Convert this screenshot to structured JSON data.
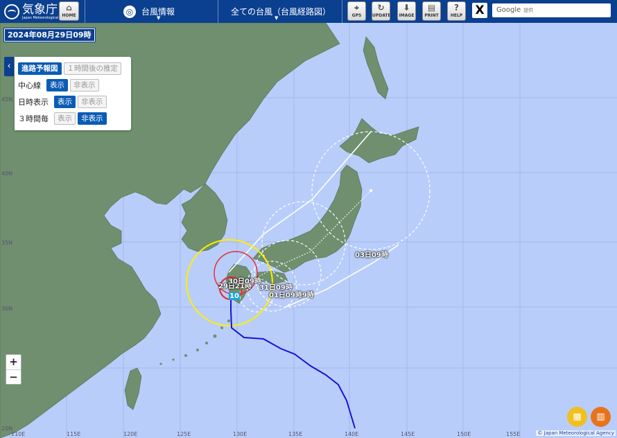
{
  "header": {
    "logo_jp": "気象庁",
    "logo_en": "Japan Meteorological Agency",
    "home_label": "HOME",
    "menu_typhoon_info": "台風情報",
    "menu_all_typhoons": "全ての台風（台風経路図）",
    "tools": [
      {
        "label": "GPS",
        "icon": "crosshair-icon"
      },
      {
        "label": "UPDATE",
        "icon": "refresh-icon"
      },
      {
        "label": "IMAGE",
        "icon": "download-icon"
      },
      {
        "label": "PRINT",
        "icon": "printer-icon"
      },
      {
        "label": "HELP",
        "icon": "question-icon"
      }
    ],
    "x_label": "X",
    "search_brand": "Google",
    "search_suffix": "提供"
  },
  "date_label": "2024年08月29日09時",
  "panel": {
    "forecast_tab": "進路予報図",
    "estimate_tab": "１時間後の推定",
    "centerline_label": "中心線",
    "datetime_label": "日時表示",
    "threehour_label": "３時間毎",
    "show": "表示",
    "hide": "非表示"
  },
  "map_labels": {
    "t1": "29日21時",
    "t2": "30日09時",
    "t3": "31日09時",
    "t4": "01日09時",
    "t4b": "9時",
    "t5": "03日09時",
    "typhoon_number": "10"
  },
  "lon_labels": [
    "110E",
    "115E",
    "120E",
    "125E",
    "130E",
    "135E",
    "140E",
    "145E",
    "150E",
    "155E"
  ],
  "lat_labels": [
    "45N",
    "40N",
    "35N",
    "30N",
    "20N"
  ],
  "zoom": {
    "in": "+",
    "out": "−"
  },
  "credit": "© Japan Meteorological Agency",
  "colors": {
    "sea": "#b9cdfb",
    "land": "#6f8f6f",
    "header": "#0b3f8f",
    "storm_warning_circle": "#ffef00",
    "gale_circle": "#e53030",
    "past_track": "#1414d4"
  }
}
